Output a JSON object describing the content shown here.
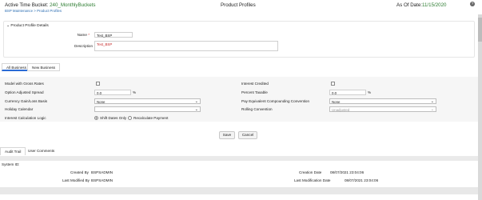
{
  "header": {
    "active_label": "Active Time Bucket: ",
    "active_value": "240_MonthlyBuckets",
    "breadcrumb": "BSP Maintenance > Product Profiles",
    "title": "Product Profiles",
    "asof_label": "As Of Date:",
    "asof_value": "11/15/2020",
    "help_icon": "?"
  },
  "details": {
    "section_title": "Product Profile Details",
    "name_label": "Name",
    "name_value": "Test_BSP",
    "desc_label": "Description",
    "desc_value": "Test_BSP"
  },
  "business_tabs": [
    "All Business",
    "New Business"
  ],
  "fields": {
    "model_gross_rates": "Model with Gross Rates",
    "interest_credited": "Interest Credited",
    "option_adjusted_spread": "Option Adjusted Spread",
    "oas_value": "0.0",
    "percent_sign": "%",
    "percent_taxable": "Percent Taxable",
    "percent_taxable_value": "0.0",
    "currency_gain_loss": "Currency Gain/Loss Basis",
    "currency_gain_loss_value": "None",
    "pay_equivalent": "Pay Equivalent Compounding Convention",
    "pay_equivalent_value": "None",
    "holiday_calendar": "Holiday Calendar",
    "holiday_calendar_value": "",
    "rolling_convention": "Rolling Convention",
    "rolling_convention_value": "Unadjusted",
    "interest_calc_logic": "Interest Calculation Logic",
    "radio_shift_dates": "Shift Dates Only",
    "radio_recalc": "Recalculate Payment"
  },
  "buttons": {
    "save": "Save",
    "cancel": "Cancel"
  },
  "bottom_tabs": [
    "Audit Trail",
    "User Comments"
  ],
  "audit": {
    "system_id_label": "System ID:",
    "created_by_label": "Created By",
    "created_by_value": "BSPSADMIN",
    "creation_date_label": "Creation Date",
    "creation_date_value": "08/07/2021 23:04:06",
    "last_modified_by_label": "Last Modified By",
    "last_modified_by_value": "BSPSADMIN",
    "last_modification_date_label": "Last Modification Date",
    "last_modification_date_value": "08/07/2021 23:04:06"
  }
}
